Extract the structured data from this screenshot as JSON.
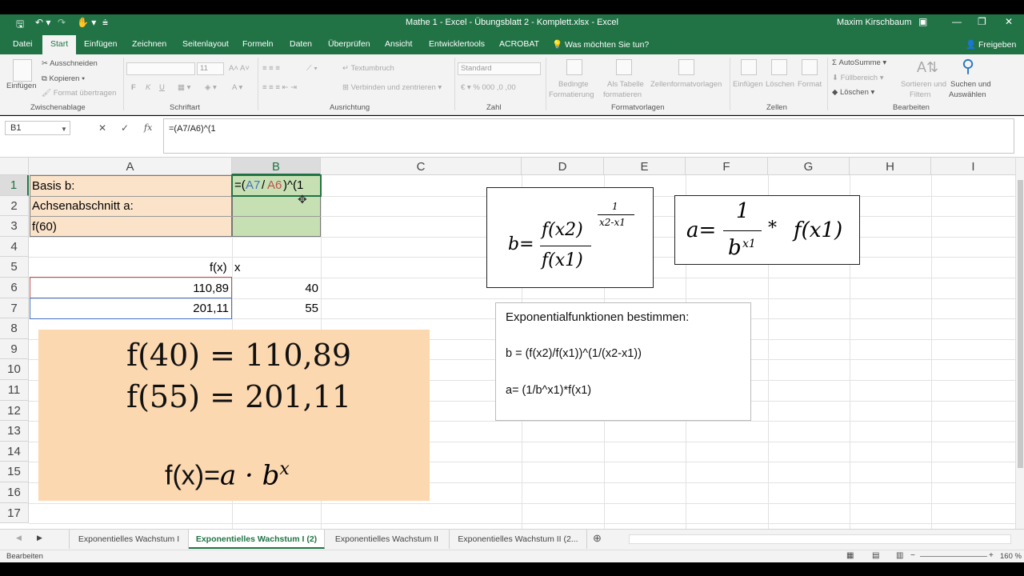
{
  "window": {
    "title": "Mathe 1 - Excel - Übungsblatt 2 - Komplett.xlsx - Excel",
    "user": "Maxim Kirschbaum"
  },
  "tabs": [
    "Datei",
    "Start",
    "Einfügen",
    "Zeichnen",
    "Seitenlayout",
    "Formeln",
    "Daten",
    "Überprüfen",
    "Ansicht",
    "Entwicklertools",
    "ACROBAT"
  ],
  "tell_me": "Was möchten Sie tun?",
  "share": "Freigeben",
  "ribbon": {
    "clipboard": {
      "paste": "Einfügen",
      "cut": "Ausschneiden",
      "copy": "Kopieren",
      "format_painter": "Format übertragen",
      "label": "Zwischenablage"
    },
    "font": {
      "size": "11",
      "bold": "F",
      "italic": "K",
      "underline": "U",
      "label": "Schriftart"
    },
    "alignment": {
      "wrap": "Textumbruch",
      "merge": "Verbinden und zentrieren",
      "label": "Ausrichtung"
    },
    "number": {
      "format": "Standard",
      "label": "Zahl"
    },
    "styles": {
      "conditional": "Bedingte",
      "conditional2": "Formatierung",
      "as_table": "Als Tabelle",
      "as_table2": "formatieren",
      "cell_styles": "Zellenformatvorlagen",
      "label": "Formatvorlagen"
    },
    "cells": {
      "insert": "Einfügen",
      "delete": "Löschen",
      "format": "Format",
      "label": "Zellen"
    },
    "editing": {
      "autosum": "AutoSumme",
      "fill": "Füllbereich",
      "clear": "Löschen",
      "sort": "Sortieren und",
      "sort2": "Filtern",
      "find": "Suchen und",
      "find2": "Auswählen",
      "label": "Bearbeiten"
    }
  },
  "formula_bar": {
    "name_box": "B1",
    "formula": "=(A7/A6)^(1"
  },
  "columns": [
    "A",
    "B",
    "C",
    "D",
    "E",
    "F",
    "G",
    "H",
    "I"
  ],
  "rows": [
    "1",
    "2",
    "3",
    "4",
    "5",
    "6",
    "7",
    "8",
    "9",
    "10",
    "11",
    "12",
    "13",
    "14",
    "15",
    "16",
    "17"
  ],
  "cells": {
    "A1": "Basis b:",
    "A2": "Achsenabschnitt a:",
    "A3": "f(60)",
    "A5": "f(x)",
    "B5": "x",
    "A6": "110,89",
    "B6": "40",
    "A7": "201,11",
    "B7": "55",
    "B1_part1": "=(",
    "B1_ref1": "A7",
    "B1_part2": "/",
    "B1_ref2": "A6",
    "B1_part3": ")^(1"
  },
  "colors": {
    "excel_green": "#217346",
    "label_fill": "#fbe3c9",
    "input_fill": "#c6e0b4",
    "ref_blue": "#4472c4",
    "ref_red": "#c0504d",
    "note_fill": "#fcd8b0"
  },
  "note_box": {
    "line1": "f(40) = 110,89",
    "line2": "f(55) = 201,11",
    "formula_base": "f(x)=",
    "formula_rest": "a · b",
    "formula_exp": "x"
  },
  "formula_box_b": {
    "lhs": "b=",
    "num": "f(x2)",
    "den": "f(x1)",
    "exp_num": "1",
    "exp_den": "x2-x1"
  },
  "formula_box_a": {
    "lhs": "a=",
    "num": "1",
    "den_base": "b",
    "den_exp": "x1",
    "times": "*",
    "rhs": "f(x1)"
  },
  "text_box": {
    "title": "Exponentialfunktionen bestimmen:",
    "line1": "b = (f(x2)/f(x1))^(1/(x2-x1))",
    "line2": "a= (1/b^x1)*f(x1)"
  },
  "sheets": [
    "Exponentielles Wachstum I",
    "Exponentielles Wachstum I (2)",
    "Exponentielles Wachstum II",
    "Exponentielles Wachstum II (2..."
  ],
  "active_sheet": 1,
  "status": {
    "mode": "Bearbeiten",
    "zoom": "160 %"
  }
}
